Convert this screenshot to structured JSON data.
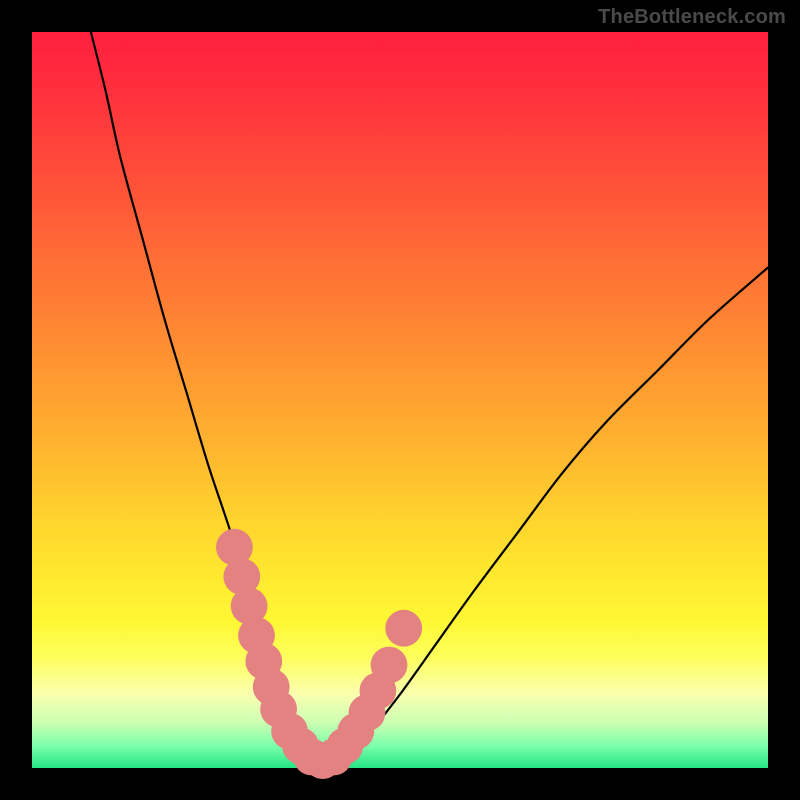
{
  "watermark": "TheBottleneck.com",
  "colors": {
    "curve": "#000000",
    "dot": "#e48282",
    "black_frame": "#000000"
  },
  "chart_data": {
    "type": "line",
    "title": "",
    "xlabel": "",
    "ylabel": "",
    "xlim": [
      0,
      100
    ],
    "ylim": [
      0,
      100
    ],
    "grid": false,
    "note": "Stylized absolute-difference / bottleneck curve; y≈0 at the minimum around x≈35–40 and rises steeply on both sides. Both axes are unlabeled; values are proportional estimates read by position within the colored square (0 = bottom/left, 100 = top/right).",
    "series": [
      {
        "name": "curve",
        "x": [
          8,
          10,
          12,
          15,
          18,
          21,
          24,
          27,
          29,
          31,
          33,
          35,
          37,
          39,
          41,
          43,
          46,
          50,
          55,
          60,
          66,
          72,
          78,
          85,
          92,
          100
        ],
        "y": [
          100,
          92,
          83,
          72,
          61,
          51,
          41,
          32,
          25,
          18,
          12,
          7,
          3,
          1,
          1,
          2,
          5,
          10,
          17,
          24,
          32,
          40,
          47,
          54,
          61,
          68
        ]
      }
    ],
    "highlight_dots": {
      "name": "sampled-points-near-minimum",
      "x": [
        27.5,
        28.5,
        29.5,
        30.5,
        31.5,
        32.5,
        33.5,
        35,
        36.5,
        38,
        39.5,
        41,
        42.5,
        44,
        45.5,
        47,
        48.5,
        50.5
      ],
      "y": [
        30,
        26,
        22,
        18,
        14.5,
        11,
        8,
        5,
        3,
        1.5,
        1,
        1.5,
        3,
        5,
        7.5,
        10.5,
        14,
        19
      ],
      "radius_approx": 2.5
    }
  }
}
